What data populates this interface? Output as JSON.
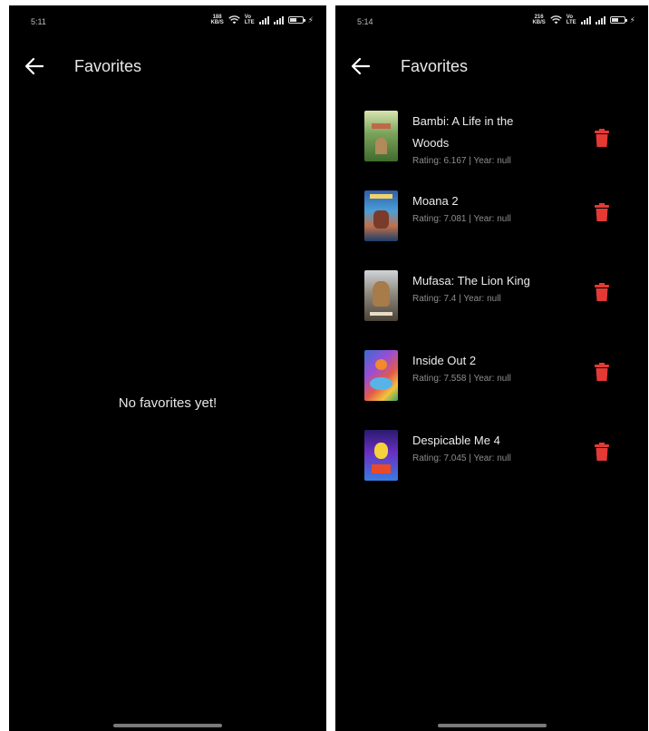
{
  "left_screen": {
    "status": {
      "time": "5:11",
      "speed_value": "188",
      "speed_unit": "KB/S"
    },
    "app_bar": {
      "title": "Favorites"
    },
    "empty_message": "No favorites yet!"
  },
  "right_screen": {
    "status": {
      "time": "5:14",
      "speed_value": "216",
      "speed_unit": "KB/S"
    },
    "app_bar": {
      "title": "Favorites"
    },
    "favorites": [
      {
        "title_line1": "Bambi: A Life in the",
        "title_line2": "Woods",
        "meta": "Rating: 6.167 | Year: null"
      },
      {
        "title_line1": "Moana 2",
        "title_line2": "",
        "meta": "Rating: 7.081 | Year: null"
      },
      {
        "title_line1": "Mufasa: The Lion King",
        "title_line2": "",
        "meta": "Rating: 7.4 | Year: null"
      },
      {
        "title_line1": "Inside Out 2",
        "title_line2": "",
        "meta": "Rating: 7.558 | Year: null"
      },
      {
        "title_line1": "Despicable Me 4",
        "title_line2": "",
        "meta": "Rating: 7.045 | Year: null"
      }
    ]
  },
  "icons": {
    "back": "arrow-back-icon",
    "delete": "trash-icon",
    "wifi": "wifi-icon",
    "signal": "signal-icon",
    "battery": "battery-icon",
    "charging": "bolt-icon"
  },
  "colors": {
    "background": "#000000",
    "text": "#ececec",
    "subtext": "#8d8d8d",
    "delete": "#e53935"
  },
  "battery_level": 0.6
}
